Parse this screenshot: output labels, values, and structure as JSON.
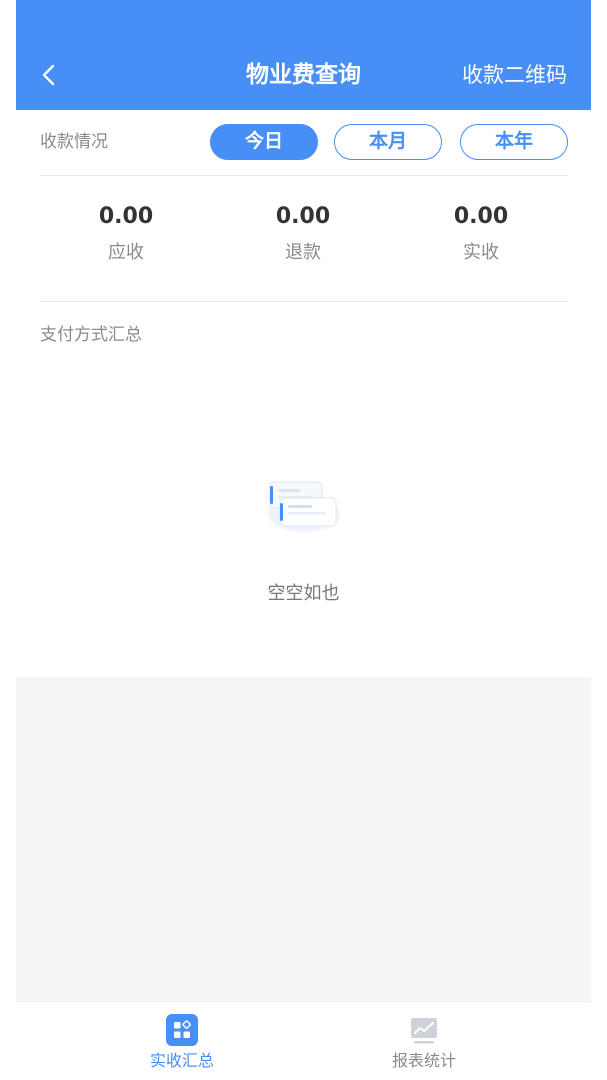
{
  "header": {
    "title": "物业费查询",
    "qr_link": "收款二维码",
    "back_icon": "chevron-left-icon"
  },
  "filter": {
    "label": "收款情况",
    "options": [
      {
        "label": "今日",
        "active": true
      },
      {
        "label": "本月",
        "active": false
      },
      {
        "label": "本年",
        "active": false
      }
    ]
  },
  "stats": [
    {
      "value": "0.00",
      "label": "应收"
    },
    {
      "value": "0.00",
      "label": "退款"
    },
    {
      "value": "0.00",
      "label": "实收"
    }
  ],
  "payment_section": {
    "title": "支付方式汇总",
    "empty_text": "空空如也",
    "empty_icon": "empty-cards-icon"
  },
  "tabbar": {
    "items": [
      {
        "label": "实收汇总",
        "icon": "grid-icon",
        "active": true
      },
      {
        "label": "报表统计",
        "icon": "chart-line-icon",
        "active": false
      }
    ]
  },
  "colors": {
    "primary": "#478ff6",
    "text_dark": "#333333",
    "text_muted": "#8a8a8a",
    "background_gray": "#f4f5f7"
  }
}
